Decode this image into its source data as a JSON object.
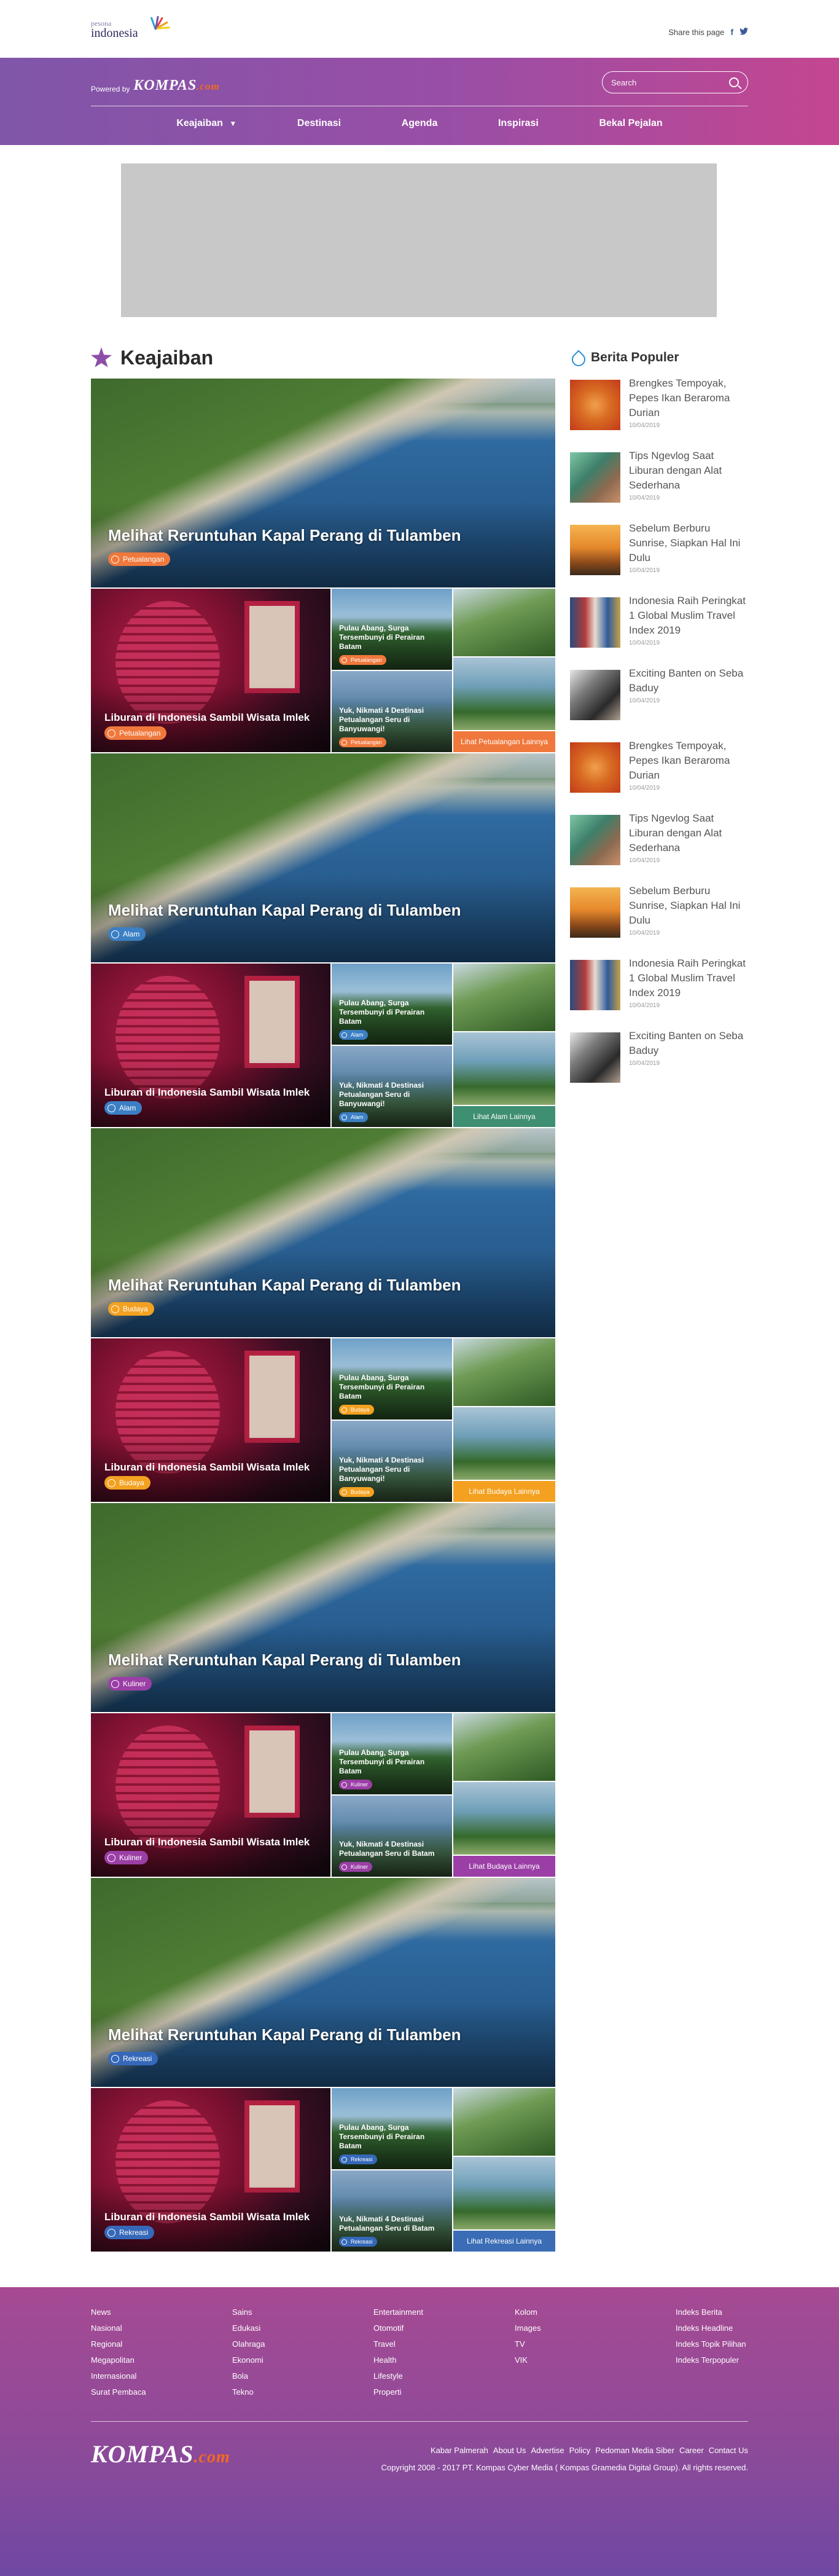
{
  "brand": {
    "logo_small": "pesona",
    "logo_big": "indonesia"
  },
  "share": {
    "label": "Share this page",
    "facebook": "f",
    "twitter": "t"
  },
  "header": {
    "powered_by": "Powered by",
    "kompas": "KOMPAS",
    "kompas_dot": ".com",
    "search_placeholder": "Search",
    "nav": [
      {
        "label": "Keajaiban",
        "arrow": "▼"
      },
      {
        "label": "Destinasi"
      },
      {
        "label": "Agenda"
      },
      {
        "label": "Inspirasi"
      },
      {
        "label": "Bekal Pejalan"
      }
    ]
  },
  "section": {
    "title": "Keajaiban"
  },
  "blocks": [
    {
      "tag_color": "#f0783c",
      "tag": "Petualangan",
      "more_color": "#f0783c",
      "more": "Lihat Petualangan Lainnya",
      "big_title": "Melihat Reruntuhan Kapal Perang di Tulamben",
      "lantern_title": "Liburan di Indonesia Sambil Wisata Imlek",
      "tile1_title": "Pulau Abang, Surga Tersembunyi di Perairan Batam",
      "tile2_title": "Yuk, Nikmati 4 Destinasi Petualangan Seru di Banyuwangi!"
    },
    {
      "tag_color": "#3b7fc4",
      "tag": "Alam",
      "more_color": "#3f8f72",
      "more": "Lihat Alam Lainnya",
      "big_title": "Melihat Reruntuhan Kapal Perang di Tulamben",
      "lantern_title": "Liburan di Indonesia Sambil Wisata Imlek",
      "tile1_title": "Pulau Abang, Surga Tersembunyi di Perairan Batam",
      "tile2_title": "Yuk, Nikmati 4 Destinasi Petualangan Seru di Banyuwangi!"
    },
    {
      "tag_color": "#f4a121",
      "tag": "Budaya",
      "more_color": "#f4a121",
      "more": "Lihat Budaya Lainnya",
      "big_title": "Melihat Reruntuhan Kapal Perang di Tulamben",
      "lantern_title": "Liburan di Indonesia Sambil Wisata Imlek",
      "tile1_title": "Pulau Abang, Surga Tersembunyi di Perairan Batam",
      "tile2_title": "Yuk, Nikmati 4 Destinasi Petualangan Seru di Banyuwangi!"
    },
    {
      "tag_color": "#9b3fa6",
      "tag": "Kuliner",
      "more_color": "#9b3fa6",
      "more": "Lihat Budaya Lainnya",
      "big_title": "Melihat Reruntuhan Kapal Perang di Tulamben",
      "lantern_title": "Liburan di Indonesia Sambil Wisata Imlek",
      "tile1_title": "Pulau Abang, Surga Tersembunyi di Perairan Batam",
      "tile2_title": "Yuk, Nikmati 4 Destinasi Petualangan Seru di Batam"
    },
    {
      "tag_color": "#3568b8",
      "tag": "Rekreasi",
      "more_color": "#3a6db5",
      "more": "Lihat Rekreasi Lainnya",
      "big_title": "Melihat Reruntuhan Kapal Perang di Tulamben",
      "lantern_title": "Liburan di Indonesia Sambil Wisata Imlek",
      "tile1_title": "Pulau Abang, Surga Tersembunyi di Perairan Batam",
      "tile2_title": "Yuk, Nikmati 4 Destinasi Petualangan Seru di Batam"
    }
  ],
  "popular": {
    "title": "Berita Populer",
    "items": [
      {
        "title": "Brengkes Tempoyak, Pepes Ikan Beraroma Durian",
        "date": "10/04/2019",
        "thumb": "a"
      },
      {
        "title": "Tips Ngevlog Saat Liburan dengan Alat Sederhana",
        "date": "10/04/2019",
        "thumb": "b"
      },
      {
        "title": "Sebelum Berburu Sunrise, Siapkan Hal Ini Dulu",
        "date": "10/04/2019",
        "thumb": "c"
      },
      {
        "title": "Indonesia Raih Peringkat 1 Global Muslim Travel Index 2019",
        "date": "10/04/2019",
        "thumb": "d"
      },
      {
        "title": "Exciting Banten on Seba Baduy",
        "date": "10/04/2019",
        "thumb": "e"
      },
      {
        "title": "Brengkes Tempoyak, Pepes Ikan Beraroma Durian",
        "date": "10/04/2019",
        "thumb": "a"
      },
      {
        "title": "Tips Ngevlog Saat Liburan dengan Alat Sederhana",
        "date": "10/04/2019",
        "thumb": "b"
      },
      {
        "title": "Sebelum Berburu Sunrise, Siapkan Hal Ini Dulu",
        "date": "10/04/2019",
        "thumb": "c"
      },
      {
        "title": "Indonesia Raih Peringkat 1 Global Muslim Travel Index 2019",
        "date": "10/04/2019",
        "thumb": "d"
      },
      {
        "title": "Exciting Banten on Seba Baduy",
        "date": "10/04/2019",
        "thumb": "e"
      }
    ]
  },
  "footer": {
    "col1": [
      "News",
      "Nasional",
      "Regional",
      "Megapolitan",
      "Internasional",
      "Surat Pembaca"
    ],
    "col2": [
      "Sains",
      "Edukasi",
      "Olahraga",
      "Ekonomi",
      "Bola",
      "Tekno"
    ],
    "col3": [
      "Entertainment",
      "Otomotif",
      "Travel",
      "Health",
      "Lifestyle",
      "Properti"
    ],
    "col4": [
      "Kolom",
      "Images",
      "TV",
      "VIK"
    ],
    "col5": [
      "Indeks Berita",
      "Indeks Headline",
      "Indeks Topik Pilihan",
      "Indeks Terpopuler"
    ],
    "links": [
      "Kabar Palmerah",
      "About Us",
      "Advertise",
      "Policy",
      "Pedoman Media Siber",
      "Career",
      "Contact Us"
    ],
    "copyright": "Copyright 2008 - 2017 PT. Kompas Cyber Media ( Kompas Gramedia Digital Group). All rights reserved."
  }
}
